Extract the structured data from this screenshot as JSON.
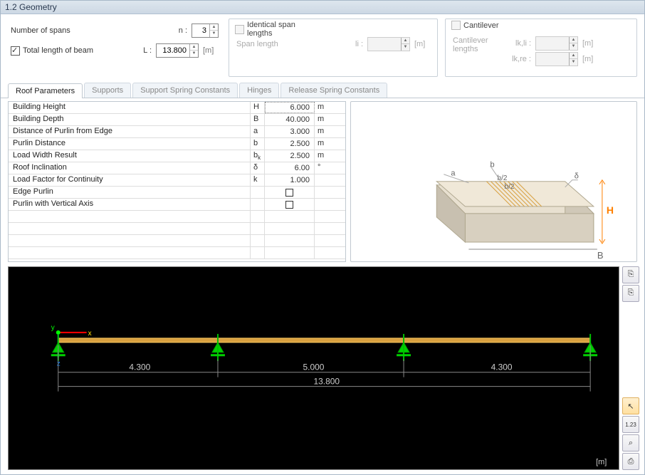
{
  "title": "1.2 Geometry",
  "spans": {
    "label": "Number of spans",
    "sym": "n :",
    "value": "3"
  },
  "totalLength": {
    "checked": "true",
    "label": "Total length of beam",
    "sym": "L :",
    "value": "13.800",
    "unit": "[m]"
  },
  "identicalSpan": {
    "title": "Identical span lengths",
    "spanLabel": "Span length",
    "sym": "li :",
    "value": "",
    "unit": "[m]"
  },
  "cantilever": {
    "title": "Cantilever",
    "lenLabel": "Cantilever lengths",
    "left": {
      "sym": "lk,li :",
      "value": "",
      "unit": "[m]"
    },
    "right": {
      "sym": "lk,re :",
      "value": "",
      "unit": "[m]"
    }
  },
  "tabs": {
    "t1": "Roof Parameters",
    "t2": "Supports",
    "t3": "Support Spring Constants",
    "t4": "Hinges",
    "t5": "Release Spring Constants"
  },
  "params": [
    {
      "label": "Building Height",
      "sym": "H",
      "value": "6.000",
      "unit": "m",
      "hl": "true"
    },
    {
      "label": "Building Depth",
      "sym": "B",
      "value": "40.000",
      "unit": "m"
    },
    {
      "label": "Distance of Purlin from Edge",
      "sym": "a",
      "value": "3.000",
      "unit": "m"
    },
    {
      "label": "Purlin Distance",
      "sym": "b",
      "value": "2.500",
      "unit": "m"
    },
    {
      "label": "Load Width Result",
      "sym": "bk",
      "value": "2.500",
      "unit": "m"
    },
    {
      "label": "Roof Inclination",
      "sym": "δ",
      "value": "6.00",
      "unit": "°"
    },
    {
      "label": "Load Factor for Continuity",
      "sym": "k",
      "value": "1.000",
      "unit": ""
    },
    {
      "label": "Edge Purlin",
      "sym": "",
      "value": "",
      "unit": "",
      "chk": "true"
    },
    {
      "label": "Purlin with Vertical Axis",
      "sym": "",
      "value": "",
      "unit": "",
      "chk": "true"
    }
  ],
  "diagram": {
    "a": "a",
    "b": "b",
    "b2a": "b/2",
    "b2b": "b/2",
    "H": "H",
    "B": "B",
    "d": "δ"
  },
  "beam": {
    "span1": "4.300",
    "span2": "5.000",
    "span3": "4.300",
    "total": "13.800",
    "unit": "[m]"
  },
  "sidebarIcons": {
    "copy": "⎘",
    "paste": "⎘",
    "pointer": "↖",
    "num": "1.23",
    "zoom": "⌕",
    "print": "⎙"
  }
}
